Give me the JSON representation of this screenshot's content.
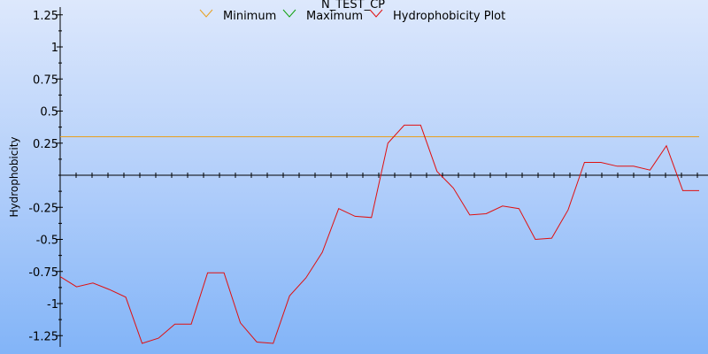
{
  "chart_data": {
    "type": "line",
    "title": "N_TEST_CP",
    "xlabel": "",
    "ylabel": "Hydrophobicity",
    "ylim": [
      -1.3,
      1.3
    ],
    "yticks": [
      {
        "value": 1.25,
        "label": "1.25"
      },
      {
        "value": 1.0,
        "label": "1"
      },
      {
        "value": 0.75,
        "label": "0.75"
      },
      {
        "value": 0.5,
        "label": "0.5"
      },
      {
        "value": 0.25,
        "label": "0.25"
      },
      {
        "value": -0.25,
        "label": "-0.25"
      },
      {
        "value": -0.5,
        "label": "-0.5"
      },
      {
        "value": -0.75,
        "label": "-0.75"
      },
      {
        "value": -1.0,
        "label": "-1"
      },
      {
        "value": -1.25,
        "label": "-1.25"
      }
    ],
    "xlim": [
      0,
      39
    ],
    "legend_position": "top",
    "series": [
      {
        "name": "Minimum",
        "color": "#e8a020",
        "values": [
          0.3,
          0.3
        ]
      },
      {
        "name": "Maximum",
        "color": "#10a010",
        "values": []
      },
      {
        "name": "Hydrophobicity Plot",
        "color": "#e01010",
        "values": [
          -0.79,
          -0.87,
          -0.84,
          -0.89,
          -0.95,
          -1.31,
          -1.27,
          -1.16,
          -1.16,
          -0.76,
          -0.76,
          -1.15,
          -1.3,
          -1.31,
          -0.94,
          -0.8,
          -0.6,
          -0.26,
          -0.32,
          -0.33,
          0.25,
          0.39,
          0.39,
          0.03,
          -0.1,
          -0.31,
          -0.3,
          -0.24,
          -0.26,
          -0.5,
          -0.49,
          -0.27,
          0.1,
          0.1,
          0.07,
          0.07,
          0.04,
          0.23,
          -0.12,
          -0.12
        ]
      }
    ]
  }
}
